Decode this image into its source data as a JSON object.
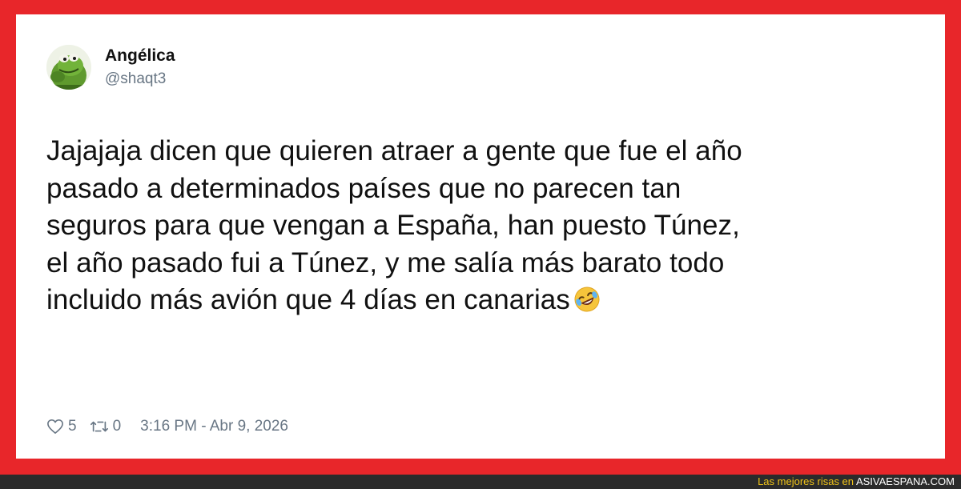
{
  "tweet": {
    "display_name": "Angélica",
    "handle": "@shaqt3",
    "avatar_icon": "kermit-frog-avatar",
    "text_lines": [
      "Jajajaja dicen que quieren atraer a gente que fue el año",
      "pasado a determinados países que no parecen tan",
      "seguros para que vengan a España, han puesto Túnez,",
      "el año pasado fui a Túnez, y me salía más barato todo",
      "incluido más avión que 4 días en canarias"
    ],
    "emoji": "rolling-on-floor-laughing-icon",
    "likes": "5",
    "retweets": "0",
    "timestamp": "3:16 PM - Abr 9, 2026"
  },
  "watermark": {
    "prefix": "Las mejores risas en",
    "site": "ASIVAESPANA.COM"
  },
  "colors": {
    "frame": "#e8262a",
    "card": "#ffffff",
    "text": "#111111",
    "muted": "#687684",
    "credit_yellow": "#f0c419"
  }
}
